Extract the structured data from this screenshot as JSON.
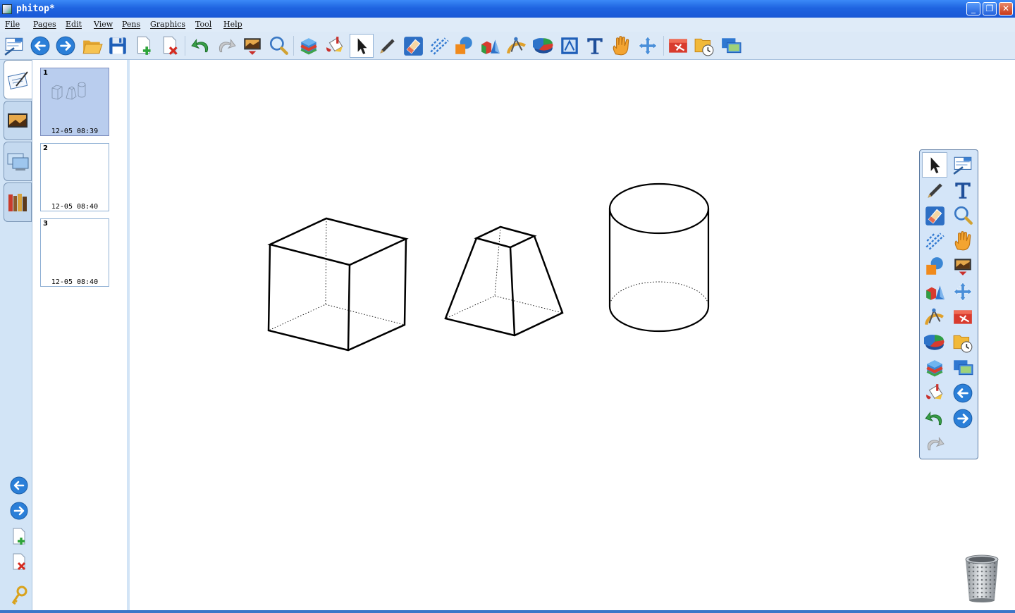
{
  "window": {
    "title": "phitop*"
  },
  "menu": [
    "File",
    "Pages",
    "Edit",
    "View",
    "Pens",
    "Graphics",
    "Tool",
    "Help"
  ],
  "toolbar": {
    "icons": [
      "pen-settings-icon",
      "back-arrow-icon",
      "forward-arrow-icon",
      "open-folder-icon",
      "save-icon",
      "add-page-icon",
      "delete-page-icon",
      "undo-icon",
      "redo-icon",
      "screen-capture-icon",
      "magnifier-icon",
      "3d-box-icon",
      "paint-bucket-icon",
      "select-arrow-icon",
      "pen-icon",
      "eraser-icon",
      "line-tool-icon",
      "shape-tool-icon",
      "3d-solid-icon",
      "compass-ruler-icon",
      "pie-chart-icon",
      "insert-image-icon",
      "text-icon",
      "hand-icon",
      "move-icon",
      "toolbox-icon",
      "timer-folder-icon",
      "display-icon"
    ],
    "active": "select-arrow-icon"
  },
  "left_tabs": [
    "whiteboard-tab-icon",
    "picture-tab-icon",
    "desktop-tab-icon",
    "library-tab-icon"
  ],
  "pages": [
    {
      "number": "1",
      "time": "12-05 08:39"
    },
    {
      "number": "2",
      "time": "12-05 08:40"
    },
    {
      "number": "3",
      "time": "12-05 08:40"
    }
  ],
  "palette": {
    "icons": [
      "select-arrow-icon",
      "pen-settings-icon",
      "pen-icon",
      "text-icon",
      "eraser-icon",
      "magnifier-icon",
      "line-tool-icon",
      "hand-icon",
      "shape-tool-icon",
      "screen-capture-icon",
      "3d-solid-icon",
      "move-icon",
      "compass-ruler-icon",
      "toolbox-icon",
      "pie-chart-icon",
      "timer-folder-icon",
      "3d-box-icon",
      "display-icon",
      "paint-bucket-icon",
      "back-arrow-icon",
      "undo-icon",
      "forward-arrow-icon",
      "redo-icon"
    ],
    "active": "select-arrow-icon"
  },
  "colors": {
    "titlebar": "#1f64e0",
    "panel": "#dce9f7",
    "accent": "#2b7fd8"
  }
}
